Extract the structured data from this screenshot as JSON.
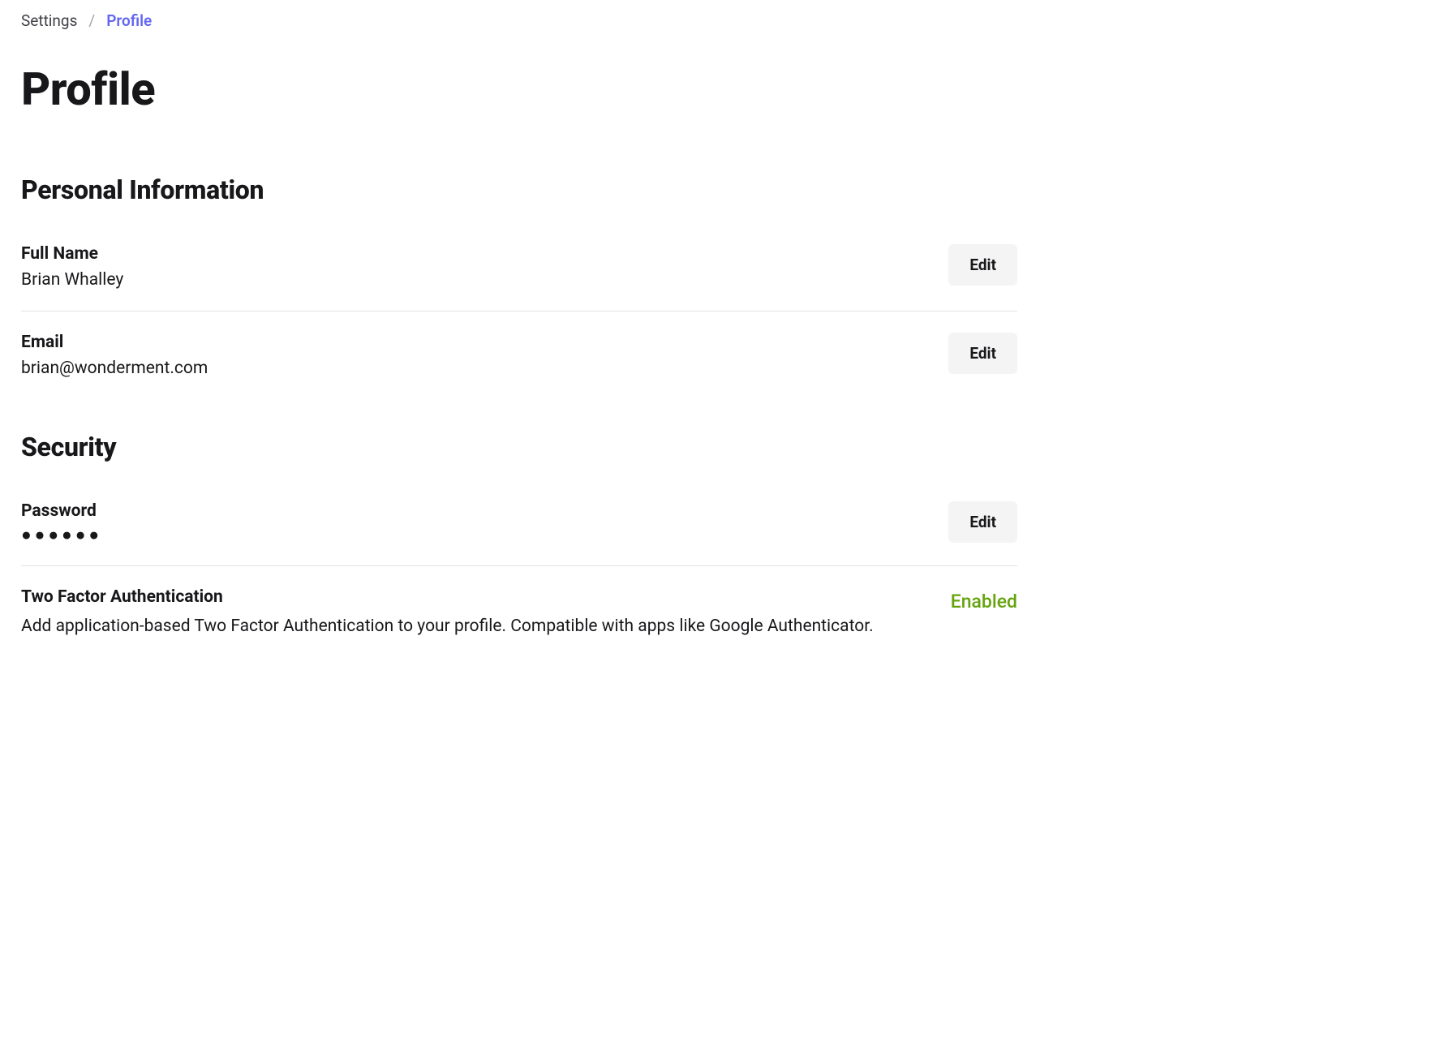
{
  "breadcrumb": {
    "parent": "Settings",
    "separator": "/",
    "current": "Profile"
  },
  "page": {
    "title": "Profile"
  },
  "sections": {
    "personal": {
      "title": "Personal Information",
      "full_name": {
        "label": "Full Name",
        "value": "Brian Whalley",
        "edit_label": "Edit"
      },
      "email": {
        "label": "Email",
        "value": "brian@wonderment.com",
        "edit_label": "Edit"
      }
    },
    "security": {
      "title": "Security",
      "password": {
        "label": "Password",
        "value": "●●●●●●",
        "edit_label": "Edit"
      },
      "two_factor": {
        "label": "Two Factor Authentication",
        "description": "Add application-based Two Factor Authentication to your profile. Compatible with apps like Google Authenticator.",
        "status": "Enabled"
      }
    }
  }
}
